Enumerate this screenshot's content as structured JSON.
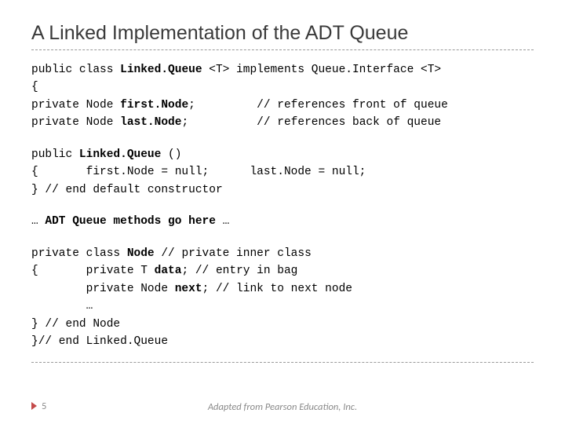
{
  "title": "A Linked Implementation of the ADT Queue",
  "code": {
    "line1a": "public class ",
    "line1b": "Linked.Queue",
    "line1c": " <T> implements Queue.Interface <T>",
    "line2": "{",
    "line3a": "private Node ",
    "line3b": "first.Node",
    "line3c": ";         // references front of queue",
    "line4a": "private Node ",
    "line4b": "last.Node",
    "line4c": ";          // references back of queue",
    "ctor1a": "public ",
    "ctor1b": "Linked.Queue",
    "ctor1c": " ()",
    "ctor2": "{       first.Node = null;      last.Node = null;",
    "ctor3": "} // end default constructor",
    "ellips1": "… ",
    "ellips_bold": "ADT Queue methods go here",
    "ellips2": " …",
    "node1a": "private class ",
    "node1b": "Node",
    "node1c": " // private inner class",
    "node2a": "{       private T ",
    "node2b": "data",
    "node2c": "; // entry in bag",
    "node3a": "        private Node ",
    "node3b": "next",
    "node3c": "; // link to next node",
    "node4": "        …",
    "node5": "} // end Node",
    "node6": "}// end Linked.Queue"
  },
  "footer": {
    "page": "5",
    "credit": "Adapted from Pearson Education, Inc."
  }
}
